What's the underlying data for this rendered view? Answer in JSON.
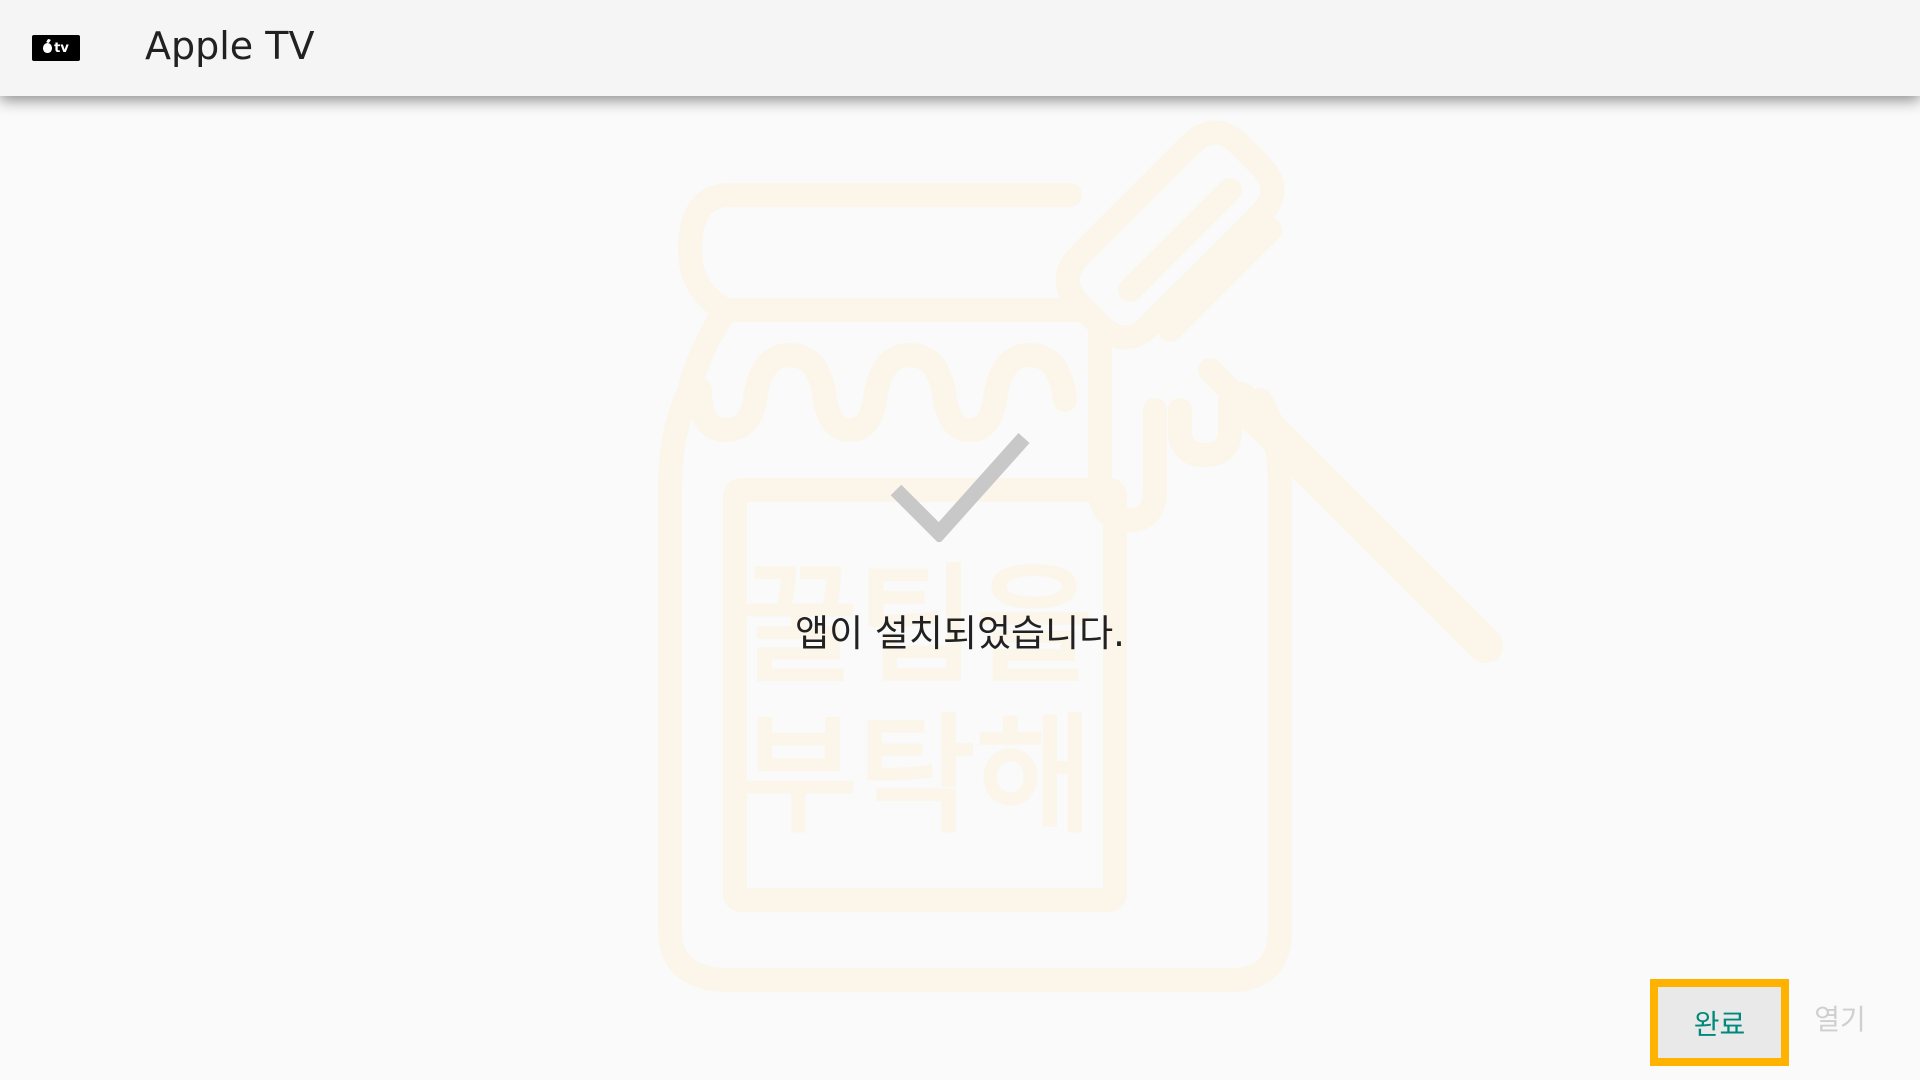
{
  "app_bar": {
    "icon_label": "tv",
    "title": "Apple TV"
  },
  "dialog": {
    "message": "앱이 설치되었습니다.",
    "done_label": "완료",
    "open_label": "열기"
  },
  "watermark": {
    "line1": "꿀팁을",
    "line2": "부탁해"
  },
  "colors": {
    "accent_focus": "#ffb300",
    "done_text": "#00897b",
    "disabled_text": "#cfcfcf",
    "check": "#c8c8c8"
  },
  "icons": [
    "apple-tv-icon",
    "check-icon",
    "honey-jar-watermark"
  ]
}
